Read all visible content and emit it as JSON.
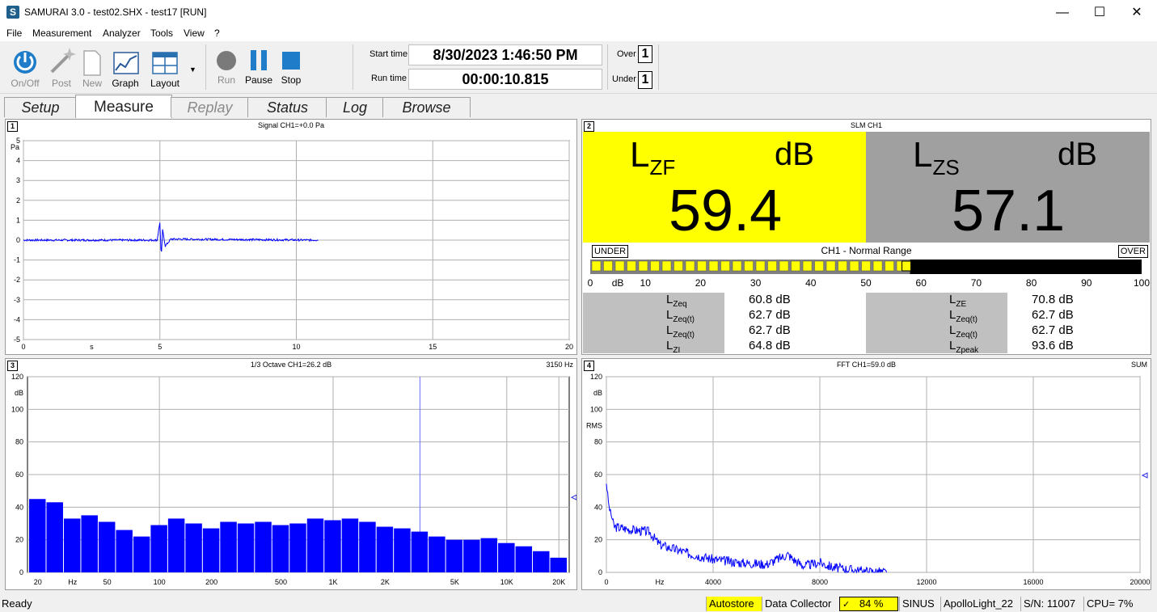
{
  "window": {
    "title": "SAMURAI 3.0 - test02.SHX - test17 [RUN]",
    "app_icon": "S"
  },
  "menu": [
    "File",
    "Measurement",
    "Analyzer",
    "Tools",
    "View",
    "?"
  ],
  "toolbar": {
    "onoff": "On/Off",
    "post": "Post",
    "new": "New",
    "graph": "Graph",
    "layout": "Layout",
    "run": "Run",
    "pause": "Pause",
    "stop": "Stop",
    "start_time_label": "Start time",
    "start_time": "8/30/2023 1:46:50 PM",
    "run_time_label": "Run time",
    "run_time": "00:00:10.815",
    "over_label": "Over",
    "over_value": "1",
    "under_label": "Under",
    "under_value": "1"
  },
  "tabs": [
    "Setup",
    "Measure",
    "Replay",
    "Status",
    "Log",
    "Browse"
  ],
  "active_tab": "Measure",
  "panel1": {
    "number": "1",
    "title": "Signal CH1=+0.0 Pa",
    "yunit": "Pa",
    "xunit": "s",
    "yticks": [
      "5",
      "4",
      "3",
      "2",
      "1",
      "0",
      "-1",
      "-2",
      "-3",
      "-4",
      "-5"
    ],
    "xticks": [
      "0",
      "5",
      "10",
      "15",
      "20"
    ]
  },
  "panel2": {
    "number": "2",
    "title": "SLM CH1",
    "left": {
      "sym": "L",
      "sub": "ZF",
      "unit": "dB",
      "value": "59.4"
    },
    "right": {
      "sym": "L",
      "sub": "ZS",
      "unit": "dB",
      "value": "57.1"
    },
    "range_title": "CH1 - Normal Range",
    "under": "UNDER",
    "over": "OVER",
    "bar_level": 58,
    "scale": [
      "0",
      "dB",
      "10",
      "20",
      "30",
      "40",
      "50",
      "60",
      "70",
      "80",
      "90",
      "100"
    ],
    "left_metrics": [
      {
        "sub": "Zeq",
        "val": "60.8 dB"
      },
      {
        "sub": "Zeq(t)",
        "val": "62.7 dB"
      },
      {
        "sub": "Zeq(t)",
        "val": "62.7 dB"
      },
      {
        "sub": "ZI",
        "val": "64.8 dB"
      }
    ],
    "right_metrics": [
      {
        "sub": "ZE",
        "val": "70.8 dB"
      },
      {
        "sub": "Zeq(t)",
        "val": "62.7 dB"
      },
      {
        "sub": "Zeq(t)",
        "val": "62.7 dB"
      },
      {
        "sub": "Zpeak",
        "val": "93.6 dB"
      }
    ],
    "colors": {
      "left_bg": "#ffff00",
      "right_bg": "#a0a0a0"
    }
  },
  "panel3": {
    "number": "3",
    "title": "1/3 Octave CH1=26.2 dB",
    "cursor": "3150 Hz",
    "yunit": "dB",
    "xunit": "Hz",
    "yticks": [
      "120",
      "100",
      "80",
      "60",
      "40",
      "20",
      "0"
    ],
    "xticks": [
      "20",
      "50",
      "100",
      "200",
      "500",
      "1K",
      "2K",
      "5K",
      "10K",
      "20K"
    ]
  },
  "panel4": {
    "number": "4",
    "title": "FFT CH1=59.0 dB",
    "mode": "SUM",
    "yunit": "dB",
    "yunit2": "RMS",
    "xunit": "Hz",
    "yticks": [
      "120",
      "100",
      "80",
      "60",
      "40",
      "20",
      "0"
    ],
    "xticks": [
      "0",
      "4000",
      "8000",
      "12000",
      "16000",
      "20000"
    ]
  },
  "chart_data": [
    {
      "type": "line",
      "title": "Signal CH1=+0.0 Pa",
      "xlabel": "s",
      "ylabel": "Pa",
      "xlim": [
        0,
        20
      ],
      "ylim": [
        -5,
        5
      ],
      "series": [
        {
          "x": [
            0,
            4.9,
            5.0,
            5.05,
            5.1,
            5.2,
            5.4,
            10.8
          ],
          "values": [
            0,
            0,
            0.9,
            -0.9,
            0.5,
            -0.3,
            0.05,
            0
          ]
        }
      ],
      "color": "#0000ff"
    },
    {
      "type": "bar",
      "title": "1/3 Octave CH1=26.2 dB",
      "xlabel": "Hz",
      "ylabel": "dB",
      "ylim": [
        0,
        120
      ],
      "categories": [
        "20",
        "25",
        "31.5",
        "40",
        "50",
        "63",
        "80",
        "100",
        "125",
        "160",
        "200",
        "250",
        "315",
        "400",
        "500",
        "630",
        "800",
        "1K",
        "1.25K",
        "1.6K",
        "2K",
        "2.5K",
        "3.15K",
        "4K",
        "5K",
        "6.3K",
        "8K",
        "10K",
        "12.5K",
        "16K",
        "20K"
      ],
      "values": [
        45,
        43,
        33,
        35,
        31,
        26,
        22,
        29,
        33,
        30,
        27,
        31,
        30,
        31,
        29,
        30,
        33,
        32,
        33,
        31,
        28,
        27,
        25,
        22,
        20,
        20,
        21,
        18,
        16,
        13,
        9
      ],
      "color": "#0000ff"
    },
    {
      "type": "line",
      "title": "FFT CH1=59.0 dB",
      "xlabel": "Hz",
      "ylabel": "dB",
      "xlim": [
        0,
        20000
      ],
      "ylim": [
        0,
        120
      ],
      "series": [
        {
          "x": [
            0,
            100,
            300,
            1000,
            1600,
            2000,
            3000,
            4000,
            5000,
            6000,
            6800,
            7000,
            7400,
            8000,
            8500,
            9500,
            10500
          ],
          "values": [
            55,
            40,
            28,
            26,
            25,
            17,
            12,
            8,
            6,
            5,
            11,
            8,
            4,
            6,
            3,
            1,
            0
          ]
        }
      ],
      "color": "#0000ff"
    }
  ],
  "statusbar": {
    "ready": "Ready",
    "autostore": "Autostore",
    "collector": "Data Collector",
    "battery": "84 %",
    "sinus": "SINUS",
    "device": "ApolloLight_22",
    "serial": "S/N: 11007",
    "cpu": "CPU=  7%"
  }
}
